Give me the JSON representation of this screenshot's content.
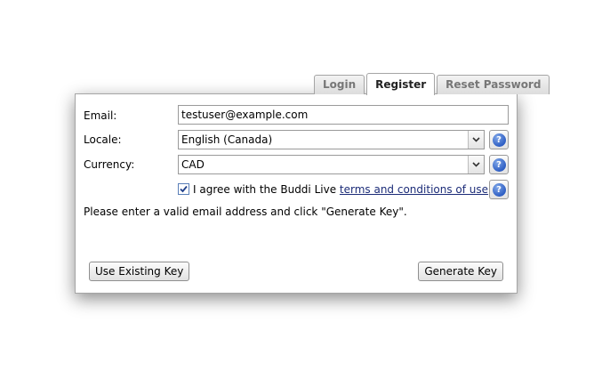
{
  "tabs": [
    {
      "label": "Login",
      "active": false
    },
    {
      "label": "Register",
      "active": true
    },
    {
      "label": "Reset Password",
      "active": false
    }
  ],
  "form": {
    "email_label": "Email:",
    "email_value": "testuser@example.com",
    "locale_label": "Locale:",
    "locale_value": "English (Canada)",
    "currency_label": "Currency:",
    "currency_value": "CAD",
    "agree_prefix": "I agree with the Buddi Live ",
    "agree_link": "terms and conditions of use",
    "agree_checked": true,
    "message": "Please enter a valid email address and click \"Generate Key\"."
  },
  "buttons": {
    "use_existing": "Use Existing Key",
    "generate": "Generate Key"
  },
  "icons": {
    "help": "help-icon",
    "dropdown": "chevron-down-icon",
    "check": "check-icon"
  },
  "colors": {
    "help_blue": "#2f5fc4",
    "link": "#1c2c78"
  }
}
